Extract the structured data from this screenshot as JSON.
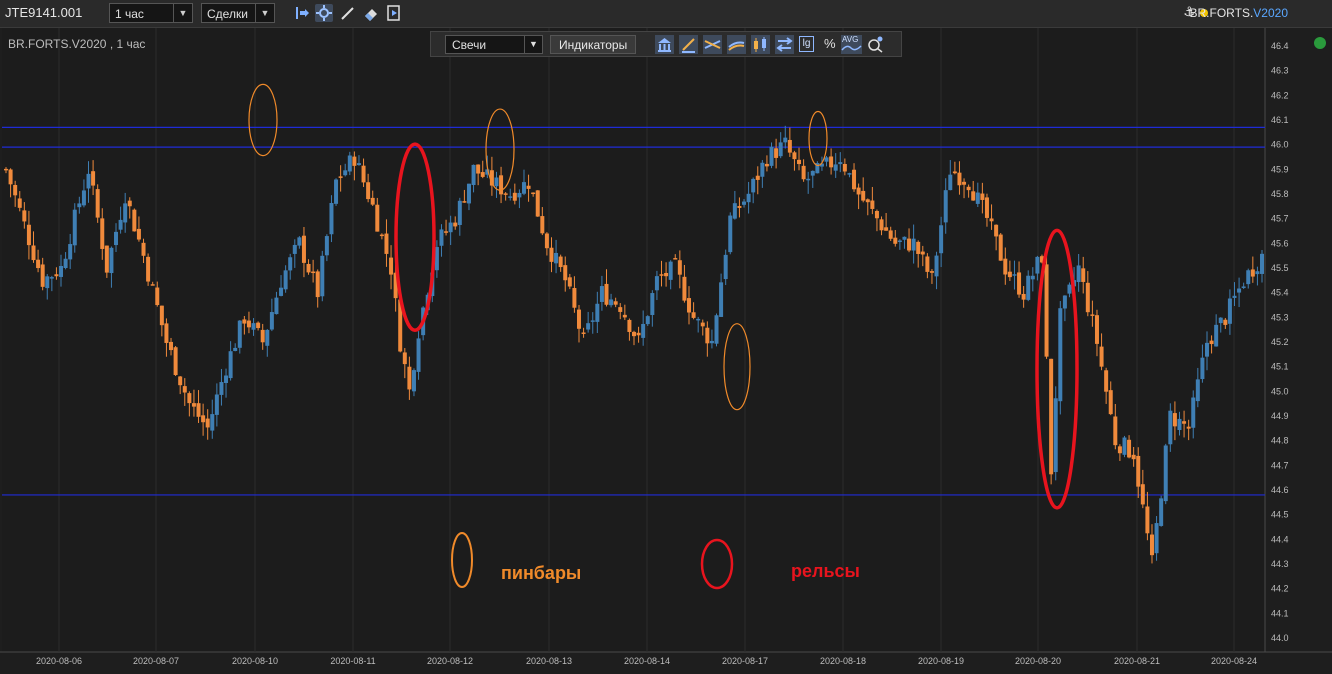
{
  "toolbar": {
    "account": "JTE9141.001",
    "timeframe": "1 час",
    "mode": "Сделки",
    "icons": [
      "trade-marker-icon",
      "settings-icon",
      "pencil-icon",
      "eraser-icon",
      "export-icon"
    ],
    "symbol_prefix": "BR.FORTS.",
    "symbol_suffix": "V2020",
    "anchor_glyph": "⚓",
    "status_color": "#f2c400"
  },
  "chart": {
    "title": "BR.FORTS.V2020 , 1 час",
    "chart_type_label": "Свечи",
    "indicators_label": "Индикаторы",
    "overlay_icons": [
      "bank-icon",
      "draw-icon",
      "cross-lines-icon",
      "multi-lines-icon",
      "candles-icon",
      "compare-icon",
      "log-scale-icon",
      "percent-icon",
      "avg-icon",
      "zoom-settings-icon"
    ],
    "log_label": "lg",
    "percent_label": "%",
    "avg_label": "AVG"
  },
  "annotations": {
    "pinbar_label": "пинбары",
    "rails_label": "рельсы",
    "pinbar_color": "#f08a2a",
    "rails_color": "#e8141e"
  },
  "chart_data": {
    "type": "candlestick",
    "ylim": [
      44.0,
      46.4
    ],
    "y_ticks": [
      "46.4",
      "46.3",
      "46.2",
      "46.1",
      "46.0",
      "45.9",
      "45.8",
      "45.7",
      "45.6",
      "45.5",
      "45.4",
      "45.3",
      "45.2",
      "45.1",
      "45.0",
      "44.9",
      "44.8",
      "44.7",
      "44.6",
      "44.5",
      "44.4",
      "44.3",
      "44.2",
      "44.1",
      "44.0"
    ],
    "x_labels": [
      "2020-08-06",
      "2020-08-07",
      "2020-08-10",
      "2020-08-11",
      "2020-08-12",
      "2020-08-13",
      "2020-08-14",
      "2020-08-17",
      "2020-08-18",
      "2020-08-19",
      "2020-08-20",
      "2020-08-21",
      "2020-08-24"
    ],
    "horizontal_levels": [
      46.07,
      45.99,
      44.58
    ],
    "up_color": "#3f7fb4",
    "down_color": "#f08a3c",
    "level_color": "#1f2bd6",
    "anchors": [
      [
        0,
        45.9
      ],
      [
        8,
        45.45
      ],
      [
        12,
        45.5
      ],
      [
        18,
        45.9
      ],
      [
        22,
        45.5
      ],
      [
        26,
        45.8
      ],
      [
        30,
        45.55
      ],
      [
        35,
        45.2
      ],
      [
        40,
        44.95
      ],
      [
        44,
        44.85
      ],
      [
        48,
        45.1
      ],
      [
        52,
        45.3
      ],
      [
        56,
        45.2
      ],
      [
        60,
        45.45
      ],
      [
        64,
        45.6
      ],
      [
        68,
        45.4
      ],
      [
        72,
        45.85
      ],
      [
        76,
        45.95
      ],
      [
        80,
        45.75
      ],
      [
        84,
        45.5
      ],
      [
        86,
        45.2
      ],
      [
        88,
        45.0
      ],
      [
        90,
        45.25
      ],
      [
        94,
        45.6
      ],
      [
        98,
        45.7
      ],
      [
        102,
        45.9
      ],
      [
        106,
        45.85
      ],
      [
        110,
        45.8
      ],
      [
        114,
        45.85
      ],
      [
        118,
        45.6
      ],
      [
        122,
        45.45
      ],
      [
        126,
        45.2
      ],
      [
        130,
        45.4
      ],
      [
        134,
        45.35
      ],
      [
        138,
        45.2
      ],
      [
        142,
        45.45
      ],
      [
        146,
        45.5
      ],
      [
        150,
        45.3
      ],
      [
        154,
        45.2
      ],
      [
        158,
        45.7
      ],
      [
        162,
        45.8
      ],
      [
        166,
        45.95
      ],
      [
        170,
        46.0
      ],
      [
        174,
        45.85
      ],
      [
        178,
        45.9
      ],
      [
        182,
        45.95
      ],
      [
        186,
        45.8
      ],
      [
        190,
        45.7
      ],
      [
        194,
        45.6
      ],
      [
        198,
        45.6
      ],
      [
        202,
        45.45
      ],
      [
        206,
        45.9
      ],
      [
        210,
        45.85
      ],
      [
        214,
        45.7
      ],
      [
        218,
        45.5
      ],
      [
        222,
        45.4
      ],
      [
        226,
        45.55
      ],
      [
        228,
        44.68
      ],
      [
        230,
        45.3
      ],
      [
        234,
        45.5
      ],
      [
        238,
        45.2
      ],
      [
        242,
        44.8
      ],
      [
        246,
        44.75
      ],
      [
        250,
        44.3
      ],
      [
        254,
        44.9
      ],
      [
        258,
        44.85
      ],
      [
        262,
        45.2
      ],
      [
        266,
        45.3
      ],
      [
        270,
        45.45
      ],
      [
        274,
        45.55
      ]
    ],
    "annotated_pinbars": [
      {
        "ref": "2020-08-11",
        "low": 45.98,
        "high": 46.22
      },
      {
        "ref": "2020-08-12",
        "low": 45.84,
        "high": 46.12
      },
      {
        "ref": "2020-08-14",
        "low": 44.95,
        "high": 45.25
      },
      {
        "ref": "2020-08-18",
        "low": 45.94,
        "high": 46.11
      }
    ],
    "annotated_rails": [
      {
        "ref": "2020-08-11",
        "low": 45.97,
        "high": 45.28
      },
      {
        "ref": "2020-08-20",
        "low": 44.56,
        "high": 45.62
      }
    ]
  }
}
